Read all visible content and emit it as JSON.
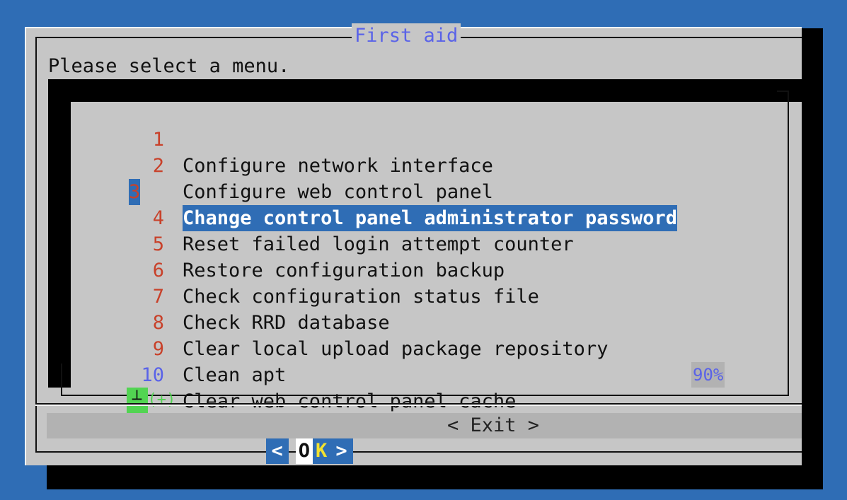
{
  "dialog": {
    "title": "First aid",
    "prompt": "Please select a menu."
  },
  "menu": {
    "items": [
      {
        "num": "1",
        "label": "Configure network interface"
      },
      {
        "num": "2",
        "label": "Configure web control panel"
      },
      {
        "num": "3",
        "label": "Change control panel administrator password"
      },
      {
        "num": "4",
        "label": "Reset failed login attempt counter"
      },
      {
        "num": "5",
        "label": "Restore configuration backup"
      },
      {
        "num": "6",
        "label": "Check configuration status file"
      },
      {
        "num": "7",
        "label": "Check RRD database"
      },
      {
        "num": "8",
        "label": "Clear local upload package repository"
      },
      {
        "num": "9",
        "label": "Clean apt"
      },
      {
        "num": "10",
        "label": "Clear web control panel cache"
      }
    ],
    "selected_index": 2,
    "scroll_indicator": "(+)",
    "scroll_percent": "90%"
  },
  "buttons": {
    "ok_left": "<",
    "ok_o": "O",
    "ok_k": "K",
    "ok_right": ">",
    "exit": "< Exit >"
  },
  "colors": {
    "background": "#2f6db5",
    "dialog": "#c6c6c6",
    "title": "#5a63e8",
    "item_number": "#c8412a",
    "selection": "#2f6db5",
    "hotkey": "#f2e230",
    "indicator": "#52d452"
  }
}
